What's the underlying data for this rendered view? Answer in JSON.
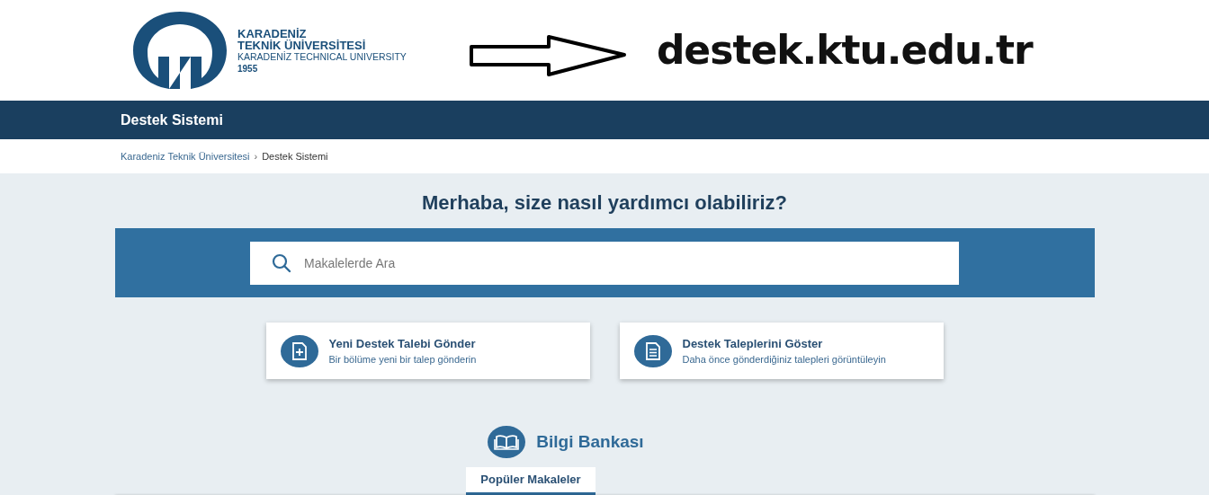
{
  "logo": {
    "lines": [
      "KARADENİZ",
      "TEKNİK ÜNİVERSİTESİ",
      "KARADENİZ TECHNICAL UNIVERSITY",
      "1955"
    ]
  },
  "annotation": {
    "url": "destek.ktu.edu.tr"
  },
  "navbar": {
    "title": "Destek Sistemi"
  },
  "breadcrumb": [
    "Karadeniz Teknik Üniversitesi",
    "Destek Sistemi"
  ],
  "breadcrumb_separator": "›",
  "hero": {
    "heading": "Merhaba, size nasıl yardımcı olabiliriz?",
    "search": {
      "placeholder": "Makalelerde Ara"
    }
  },
  "actions": [
    {
      "kind": "new",
      "title": "Yeni Destek Talebi Gönder",
      "subtitle": "Bir bölüme yeni bir talep gönderin"
    },
    {
      "kind": "list",
      "title": "Destek Taleplerini Göster",
      "subtitle": "Daha önce gönderdiğiniz talepleri görüntüleyin"
    }
  ],
  "knowledge_base": {
    "title": "Bilgi Bankası",
    "tabs": [
      {
        "label": "Popüler Makaleler",
        "selected": true
      }
    ]
  }
}
